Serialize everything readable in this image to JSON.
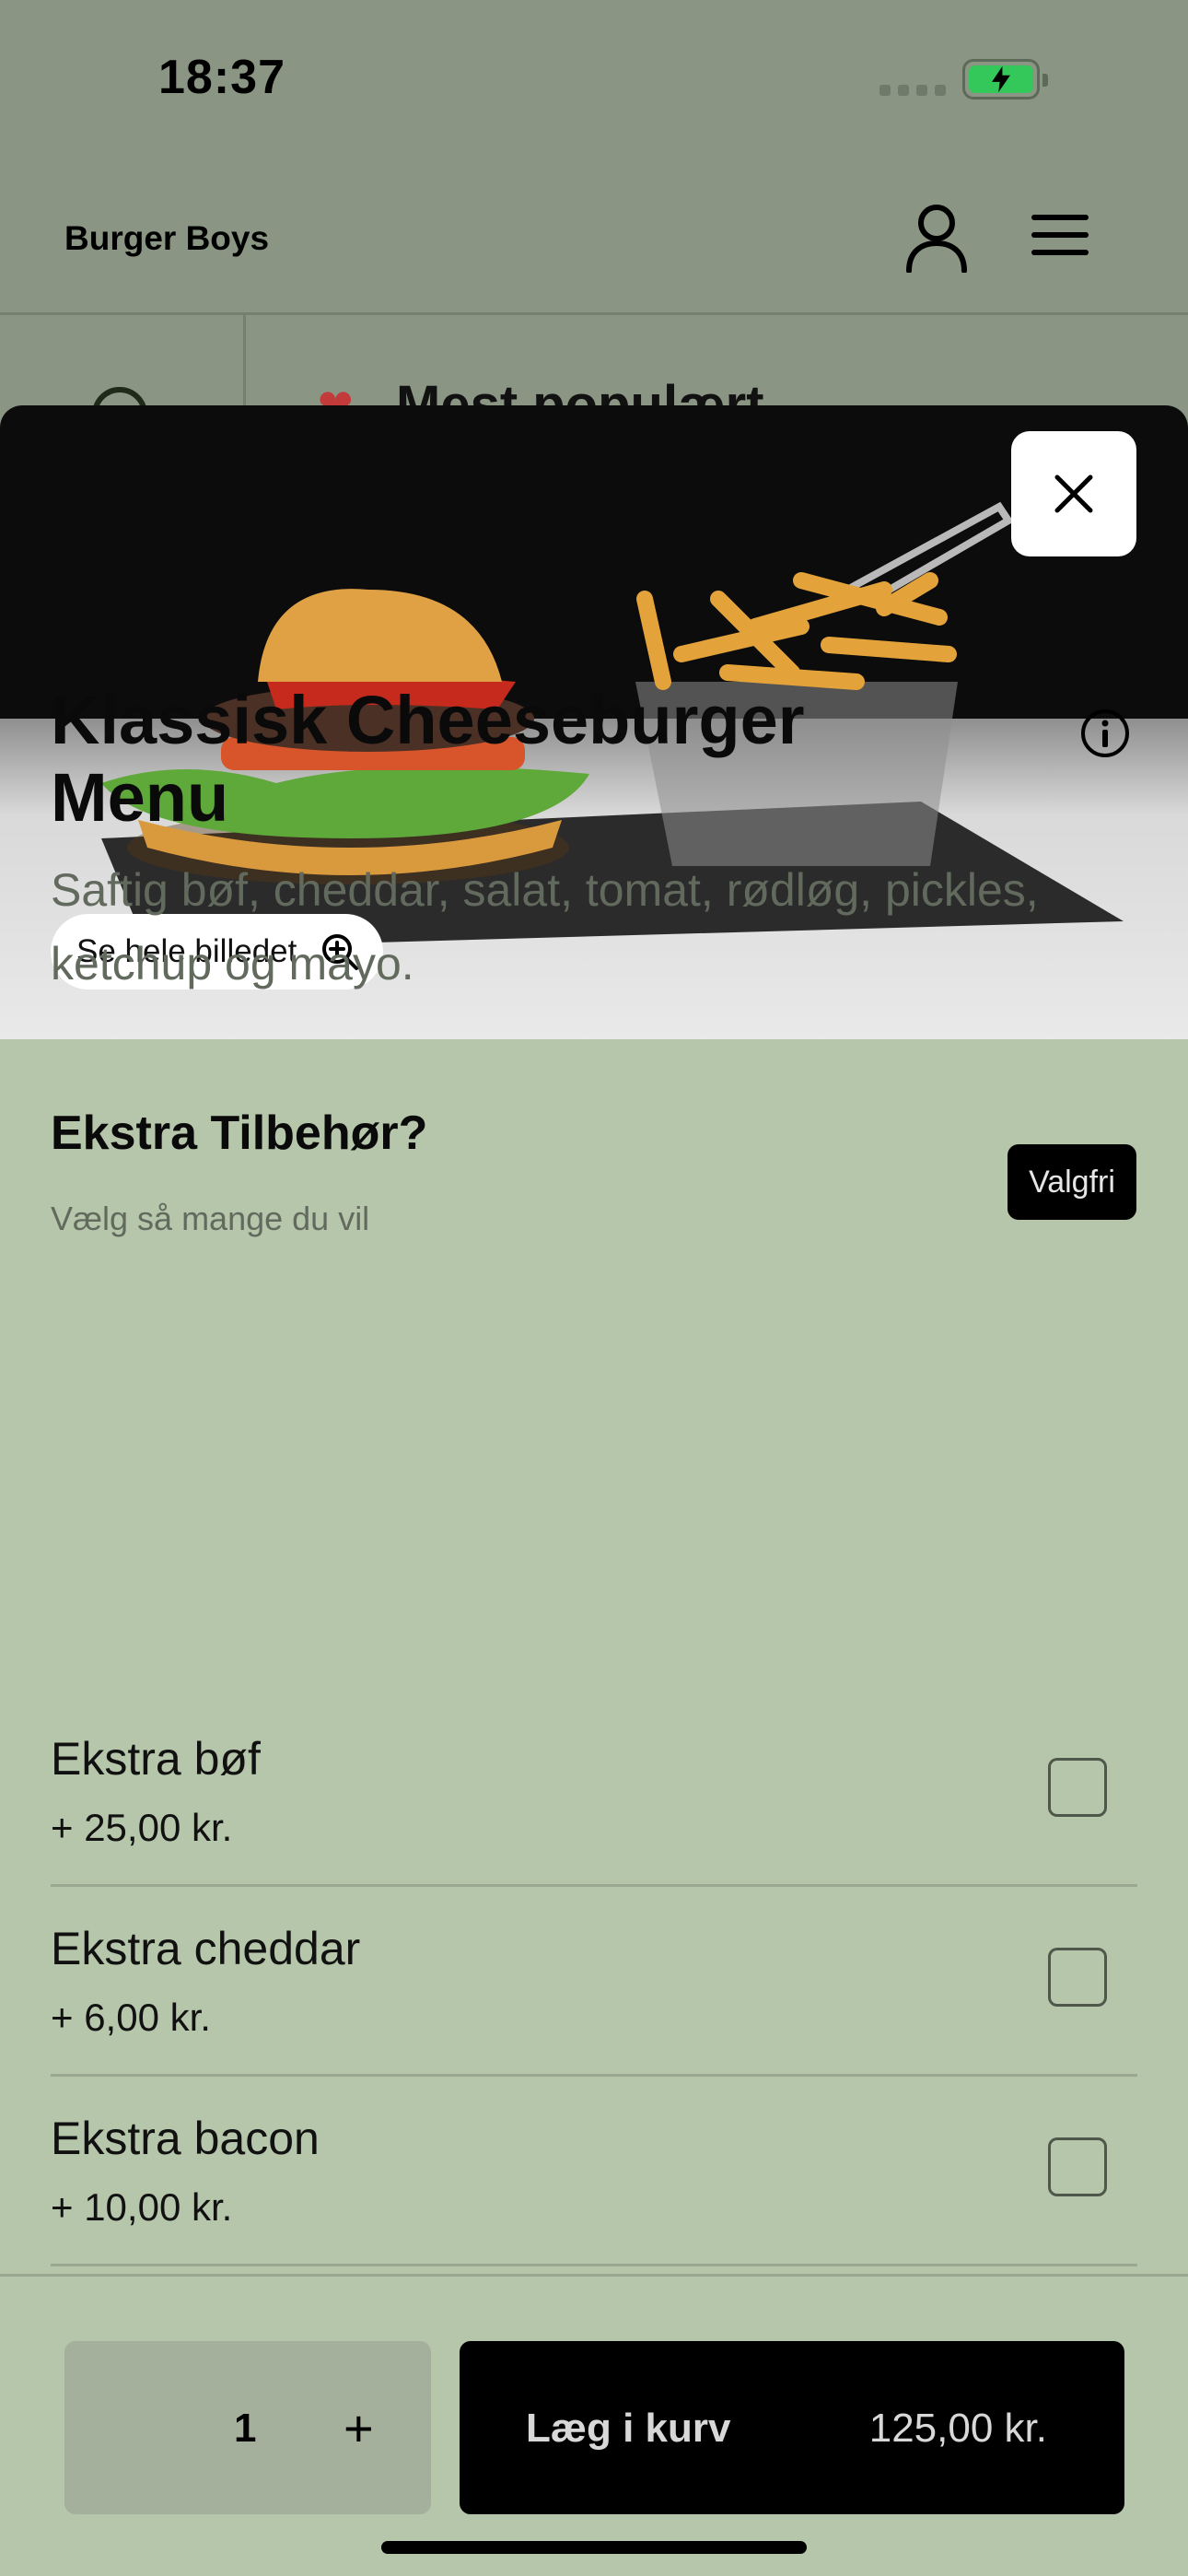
{
  "status_bar": {
    "time": "18:37"
  },
  "header": {
    "brand": "Burger Boys"
  },
  "background_category": {
    "label": "Mest populært"
  },
  "product": {
    "image_button": "Se hele billedet",
    "title": "Klassisk Cheeseburger Menu",
    "description": "Saftig bøf, cheddar, salat, tomat, rødløg, pickles, ketchup og mayo."
  },
  "extras": {
    "title": "Ekstra Tilbehør?",
    "subtitle": "Vælg så mange du vil",
    "badge": "Valgfri",
    "options": [
      {
        "name": "Ekstra bøf",
        "price": "+ 25,00 kr."
      },
      {
        "name": "Ekstra cheddar",
        "price": "+ 6,00 kr."
      },
      {
        "name": "Ekstra bacon",
        "price": "+ 10,00 kr."
      }
    ]
  },
  "cart": {
    "quantity": "1",
    "plus": "+",
    "add_label": "Læg i kurv",
    "total": "125,00 kr."
  },
  "colors": {
    "sheet_background": "#b6c6ab",
    "header_background": "#8a9683",
    "primary_button": "#000000",
    "battery": "#34c759"
  },
  "icons": [
    "user-icon",
    "menu-icon",
    "close-icon",
    "zoom-in-icon",
    "info-icon",
    "search-icon",
    "heart-icon"
  ]
}
